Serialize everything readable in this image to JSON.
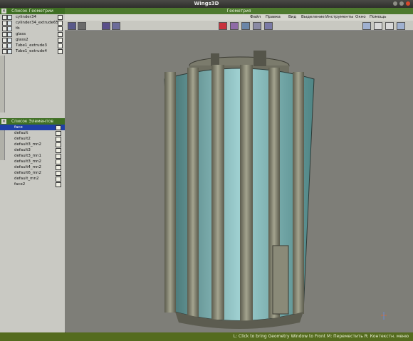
{
  "window": {
    "title": "Wings3D"
  },
  "geometry_window": {
    "title": "Геометрия"
  },
  "menu": {
    "items": [
      "Файл",
      "Правка",
      "Вид",
      "Выделение",
      "Инструменты",
      "Окно",
      "Помощь"
    ]
  },
  "outliner": {
    "title": "Список Геометрии",
    "rows": [
      {
        "label": "cylinder34"
      },
      {
        "label": "cylinder34_extrude65"
      },
      {
        "label": "tb"
      },
      {
        "label": "glass"
      },
      {
        "label": "glass2"
      },
      {
        "label": "Tube1_extrude3"
      },
      {
        "label": "Tube1_extrude4"
      }
    ]
  },
  "materials": {
    "title": "Список Элементов",
    "rows": [
      {
        "label": "face",
        "selected": true
      },
      {
        "label": "default"
      },
      {
        "label": "default2"
      },
      {
        "label": "default3_mn2"
      },
      {
        "label": "default3"
      },
      {
        "label": "default3_mn1"
      },
      {
        "label": "default3_mn2"
      },
      {
        "label": "default4_mn2"
      },
      {
        "label": "default6_mn2"
      },
      {
        "label": "default_mn2"
      },
      {
        "label": "face2"
      }
    ]
  },
  "status": {
    "text": "L: Click to bring Geometry Window to Front   M: Переместить   R: Контекстн. меню"
  },
  "colors": {
    "accent_green": "#4e7a2f",
    "selection_blue": "#1f3fa7"
  }
}
